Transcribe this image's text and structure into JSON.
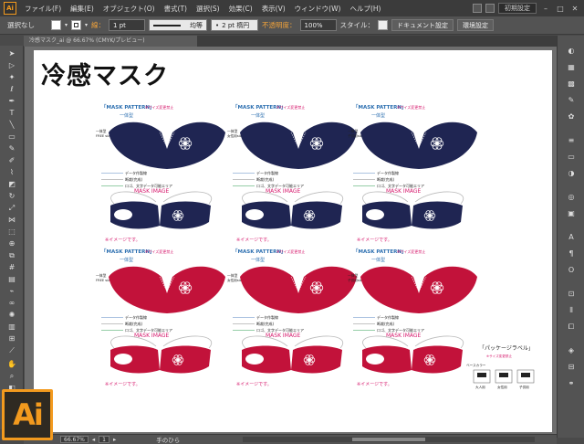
{
  "app": {
    "logo_text": "Ai",
    "menu": [
      "ファイル(F)",
      "編集(E)",
      "オブジェクト(O)",
      "書式(T)",
      "選択(S)",
      "効果(C)",
      "表示(V)",
      "ウィンドウ(W)",
      "ヘルプ(H)"
    ],
    "workspace": "初期設定"
  },
  "control_bar": {
    "selection_label": "選択なし",
    "stroke_label": "線：",
    "stroke_value": "1 pt",
    "profile_label": "均等",
    "brush_value": "2 pt 楕円",
    "opacity_label": "不透明度：",
    "opacity_value": "100%",
    "style_label": "スタイル：",
    "doc_settings_button": "ドキュメント設定",
    "env_settings_button": "環境設定"
  },
  "tab": {
    "title": "冷感マスク_ai @ 66.67% (CMYK/プレビュー)"
  },
  "document": {
    "title": "冷感マスク",
    "panels": [
      {
        "pattern_title": "「MASK PATTERN」",
        "note": "※サイズ変更禁止",
        "subtitle": "一体型",
        "size_label": "一体型",
        "size_text": "FREE size",
        "legend": [
          "データ作製線",
          "断裁(完成)",
          "ロゴ、文字データ可能エリア"
        ],
        "image_title": "MASK IMAGE",
        "image_note": "※イメージです。"
      },
      {
        "pattern_title": "「MASK PATTERN」",
        "note": "※サイズ変更禁止",
        "subtitle": "一体型",
        "size_label": "一体型",
        "size_text": "女性用size",
        "legend": [
          "データ作製線",
          "断裁(完成)",
          "ロゴ、文字データ可能エリア"
        ],
        "image_title": "MASK IMAGE",
        "image_note": "※イメージです。"
      },
      {
        "pattern_title": "「MASK PATTERN」",
        "note": "※サイズ変更禁止",
        "subtitle": "一体型",
        "size_label": "一体型",
        "size_text": "子供用size",
        "legend": [
          "データ作製線",
          "断裁(完成)",
          "ロゴ、文字データ可能エリア"
        ],
        "image_title": "MASK IMAGE",
        "image_note": "※イメージです。"
      },
      {
        "pattern_title": "「MASK PATTERN」",
        "note": "※サイズ変更禁止",
        "subtitle": "一体型",
        "size_label": "一体型",
        "size_text": "FREE size",
        "legend": [
          "データ作製線",
          "断裁(完成)",
          "ロゴ、文字データ可能エリア"
        ],
        "image_title": "MASK IMAGE",
        "image_note": "※イメージです。"
      },
      {
        "pattern_title": "「MASK PATTERN」",
        "note": "※サイズ変更禁止",
        "subtitle": "一体型",
        "size_label": "一体型",
        "size_text": "女性用size",
        "legend": [
          "データ作製線",
          "断裁(完成)",
          "ロゴ、文字データ可能エリア"
        ],
        "image_title": "MASK IMAGE",
        "image_note": "※イメージです。"
      },
      {
        "pattern_title": "「MASK PATTERN」",
        "note": "※サイズ変更禁止",
        "subtitle": "一体型",
        "size_label": "一体型",
        "size_text": "子供用size",
        "legend": [
          "データ作製線",
          "断裁(完成)",
          "ロゴ、文字データ可能エリア"
        ],
        "image_title": "MASK IMAGE",
        "image_note": "※イメージです。"
      }
    ],
    "package": {
      "title": "「パッケージラベル」",
      "note": "※サイズ変更禁止",
      "label": "ベースカラー",
      "sizes": [
        "大人用",
        "女性用",
        "子供用"
      ]
    }
  },
  "status_bar": {
    "zoom": "66.67%",
    "page": "1",
    "tool": "手のひら"
  },
  "colors": {
    "navy": "#1f2552",
    "crimson": "#c2123a",
    "pattern_blue": "#2c6fb0",
    "note_red": "#d6186c",
    "legend_green": "#2f9e52",
    "legend_blue": "#5a88c4",
    "ai_orange": "#f39a1e"
  }
}
